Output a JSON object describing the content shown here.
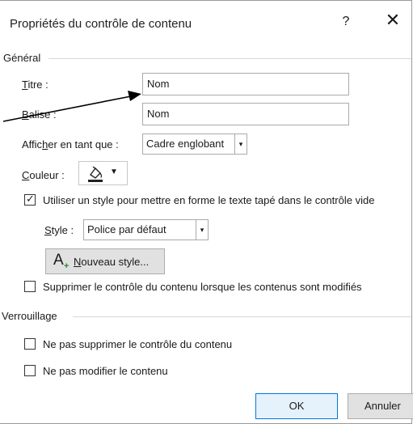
{
  "dialog": {
    "title": "Propriétés du contrôle de contenu",
    "help_label": "?",
    "close_label": "✕"
  },
  "general": {
    "section_label": "Général",
    "title_label": "Titre :",
    "title_accesskey": "T",
    "title_value": "Nom",
    "tag_label": "Balise :",
    "tag_accesskey": "B",
    "tag_value": "Nom",
    "display_label": "Afficher en tant que :",
    "display_value": "Cadre englobant",
    "color_label": "Couleur :",
    "color_accesskey": "C",
    "use_style_label": "Utiliser un style pour mettre en forme le texte tapé dans le contrôle vide",
    "use_style_checked": true,
    "style_label": "Style :",
    "style_accesskey": "S",
    "style_value": "Police par défaut",
    "new_style_icon": "A",
    "new_style_label": "Nouveau style...",
    "new_style_accesskey": "N",
    "remove_label": "Supprimer le contrôle du contenu lorsque les contenus sont modifiés",
    "remove_checked": false
  },
  "locking": {
    "section_label": "Verrouillage",
    "no_delete_label": "Ne pas supprimer le contrôle du contenu",
    "no_delete_checked": false,
    "no_edit_label": "Ne pas modifier le contenu",
    "no_edit_checked": false
  },
  "footer": {
    "ok_label": "OK",
    "cancel_label": "Annuler"
  },
  "colors": {
    "accent": "#0078d7",
    "button_bg": "#e1e1e1"
  },
  "icons": {
    "paint_bucket": "paint-bucket-icon",
    "dropdown": "chevron-down-icon",
    "new_style": "new-style-icon"
  }
}
